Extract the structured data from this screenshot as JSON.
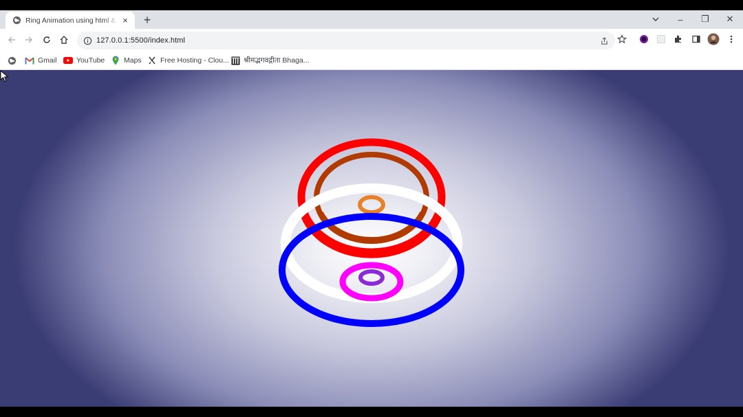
{
  "browser": {
    "tab": {
      "title": "Ring Animation using html & css",
      "close_label": "×"
    },
    "new_tab_label": "+",
    "window_controls": {
      "minimize": "–",
      "restore": "❐",
      "close": "✕"
    },
    "address": {
      "url": "127.0.0.1:5500/index.html"
    }
  },
  "bookmarks": [
    {
      "label": "",
      "icon": "globe-icon"
    },
    {
      "label": "Gmail",
      "icon": "gmail-icon"
    },
    {
      "label": "YouTube",
      "icon": "youtube-icon"
    },
    {
      "label": "Maps",
      "icon": "maps-icon"
    },
    {
      "label": "Free Hosting - Clou...",
      "icon": "hosting-icon"
    },
    {
      "label": "श्रीमद्भगवद्गीता Bhaga...",
      "icon": "temple-icon"
    }
  ],
  "rings": {
    "colors": [
      "#ff0000",
      "#b03a00",
      "#e8822a",
      "#ffffff",
      "#0000ff",
      "#ff00ff",
      "#8a2bd6"
    ]
  }
}
